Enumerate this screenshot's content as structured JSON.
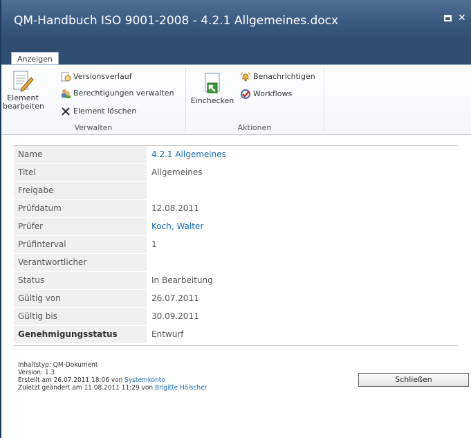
{
  "window": {
    "title": "QM-Handbuch ISO 9001-2008 - 4.2.1 Allgemeines.docx"
  },
  "ribbon": {
    "tabs": [
      {
        "label": "Anzeigen"
      }
    ],
    "groups": {
      "verwalten": {
        "label": "Verwalten",
        "edit_item_line1": "Element",
        "edit_item_line2": "bearbeiten",
        "version_history": "Versionsverlauf",
        "manage_permissions": "Berechtigungen verwalten",
        "delete_item": "Element löschen"
      },
      "aktionen": {
        "label": "Aktionen",
        "checkin": "Einchecken",
        "alert_me": "Benachrichtigen",
        "workflows": "Workflows"
      }
    }
  },
  "properties": [
    {
      "key": "Name",
      "value": "4.2.1 Allgemeines",
      "link": true
    },
    {
      "key": "Titel",
      "value": "Allgemeines"
    },
    {
      "key": "Freigabe",
      "value": ""
    },
    {
      "key": "Prüfdatum",
      "value": "12.08.2011"
    },
    {
      "key": "Prüfer",
      "value": "Koch, Walter",
      "link": true
    },
    {
      "key": "Prüfinterval",
      "value": "1"
    },
    {
      "key": "Verantwortlicher",
      "value": ""
    },
    {
      "key": "Status",
      "value": "In Bearbeitung"
    },
    {
      "key": "Gültig von",
      "value": "26.07.2011"
    },
    {
      "key": "Gültig bis",
      "value": "30.09.2011"
    },
    {
      "key": "Genehmigungsstatus",
      "value": "Entwurf",
      "bold": true
    }
  ],
  "footer": {
    "content_type": "Inhaltstyp: QM-Dokument",
    "version": "Version: 1.3",
    "created_prefix": "Erstellt am 26.07.2011 18:06 von ",
    "created_by": "Systemkonto",
    "modified_prefix": "Zuletzt geändert am 11.08.2011 11:29 von ",
    "modified_by": "Brigitte Hölscher",
    "close_button": "Schließen"
  },
  "colors": {
    "titlebar": "#38577d",
    "link": "#1d6bb4",
    "label_bg": "#f0f0f0"
  }
}
